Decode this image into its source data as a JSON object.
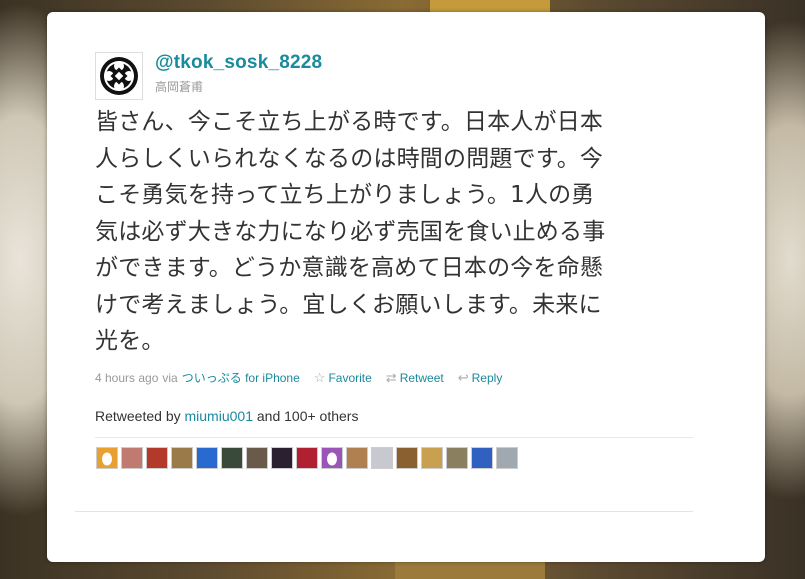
{
  "tweet": {
    "username": "@tkok_sosk_8228",
    "full_name": "高岡蒼甫",
    "text": "皆さん、今こそ立ち上がる時です。日本人が日本人らしくいられなくなるのは時間の問題です。今こそ勇気を持って立ち上がりましょう。1人の勇気は必ず大きな力になり必ず売国を食い止める事ができます。どうか意識を高めて日本の今を命懸けで考えましょう。宜しくお願いします。未来に光を。",
    "time": "4 hours ago",
    "via_label": "via",
    "client": "ついっぷる for iPhone"
  },
  "actions": {
    "favorite": "Favorite",
    "retweet": "Retweet",
    "reply": "Reply"
  },
  "retweets": {
    "prefix": "Retweeted by",
    "user": "miumiu001",
    "suffix": "and 100+ others"
  },
  "retweeter_avatars": [
    {
      "icon": "egg-avatar",
      "color": "#e8a030"
    },
    {
      "icon": "person-avatar",
      "color": "#c07a70"
    },
    {
      "icon": "flower-avatar",
      "color": "#b33a2a"
    },
    {
      "icon": "photo-avatar",
      "color": "#9a7a48"
    },
    {
      "icon": "blue-graphic-avatar",
      "color": "#2a6ad0"
    },
    {
      "icon": "dark-photo-avatar",
      "color": "#3a4a3a"
    },
    {
      "icon": "cat-avatar",
      "color": "#6a5a4a"
    },
    {
      "icon": "dark-avatar",
      "color": "#2a2030"
    },
    {
      "icon": "red-flower-avatar",
      "color": "#b02030"
    },
    {
      "icon": "egg-avatar",
      "color": "#9a55b8"
    },
    {
      "icon": "bird-avatar",
      "color": "#b08050"
    },
    {
      "icon": "question-avatar",
      "color": "#c8c8d0"
    },
    {
      "icon": "brown-avatar",
      "color": "#8a6030"
    },
    {
      "icon": "food-avatar",
      "color": "#c8a050"
    },
    {
      "icon": "character-avatar",
      "color": "#8a8060"
    },
    {
      "icon": "wave-avatar",
      "color": "#3060c0"
    },
    {
      "icon": "bottles-avatar",
      "color": "#a0a8b0"
    }
  ],
  "colors": {
    "link": "#1a8a9e",
    "muted": "#999999",
    "text": "#333333"
  }
}
